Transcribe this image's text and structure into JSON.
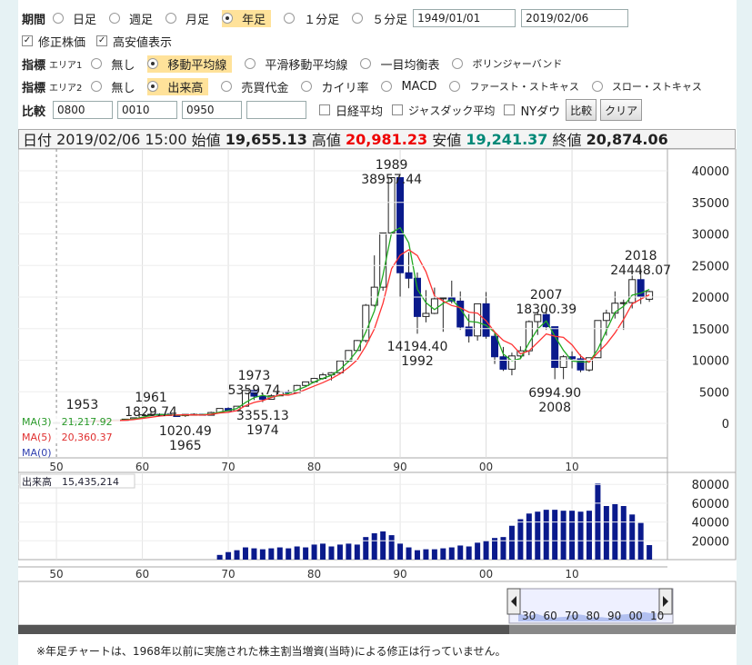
{
  "controls": {
    "period_label": "期間",
    "period_options": [
      "日足",
      "週足",
      "月足",
      "年足",
      "１分足",
      "５分足"
    ],
    "period_selected": "年足",
    "date_from": "1949/01/01",
    "date_to": "2019/02/06",
    "adjusted_label": "修正株価",
    "highlow_label": "高安値表示",
    "indicator_label": "指標",
    "area1_label": "エリア1",
    "area1_options": [
      "無し",
      "移動平均線",
      "平滑移動平均線",
      "一目均衡表",
      "ボリンジャーバンド"
    ],
    "area1_selected": "移動平均線",
    "area2_label": "エリア2",
    "area2_options": [
      "無し",
      "出来高",
      "売買代金",
      "カイリ率",
      "MACD",
      "ファースト・ストキャス",
      "スロー・ストキャス"
    ],
    "area2_selected": "出来高",
    "compare_label": "比較",
    "compare_codes": [
      "0800",
      "0010",
      "0950",
      ""
    ],
    "compare_checks": [
      "日経平均",
      "ジャスダック平均",
      "NYダウ"
    ],
    "compare_button": "比較",
    "clear_button": "クリア"
  },
  "info": {
    "date_label": "日付",
    "date_value": "2019/02/06 15:00",
    "open_label": "始値",
    "open_value": "19,655.13",
    "high_label": "高値",
    "high_value": "20,981.23",
    "low_label": "安値",
    "low_value": "19,241.37",
    "close_label": "終値",
    "close_value": "20,874.06"
  },
  "ma_legend": [
    "MA(3)　21,217.92",
    "MA(5)　20,360.37",
    "MA(0)"
  ],
  "volume_legend": "出来高　15,435,214",
  "x_ticks": [
    "50",
    "60",
    "70",
    "80",
    "90",
    "00",
    "10"
  ],
  "price_ticks": [
    "40000",
    "35000",
    "30000",
    "25000",
    "20000",
    "15000",
    "10000",
    "5000",
    "0"
  ],
  "volume_ticks": [
    "80000",
    "60000",
    "40000",
    "20000"
  ],
  "annotations": [
    {
      "line1": "1953",
      "line2": ""
    },
    {
      "line1": "1961",
      "line2": "1829.74"
    },
    {
      "line1": "1020.49",
      "line2": "1965"
    },
    {
      "line1": "1973",
      "line2": "5359.74"
    },
    {
      "line1": "3355.13",
      "line2": "1974"
    },
    {
      "line1": "1989",
      "line2": "38957.44"
    },
    {
      "line1": "14194.40",
      "line2": "1992"
    },
    {
      "line1": "2007",
      "line2": "18300.39"
    },
    {
      "line1": "6994.90",
      "line2": "2008"
    },
    {
      "line1": "2018",
      "line2": "24448.07"
    }
  ],
  "navigator_ticks": [
    "30",
    "60",
    "70",
    "80",
    "90",
    "00",
    "10"
  ],
  "footnote": "※年足チャートは、1968年以前に実施された株主割当増資(当時)による修正は行っていません。",
  "colors": {
    "up": "#ffffff",
    "down": "#0a1a8c",
    "ma3": "#22aa22",
    "ma5": "#ff3333",
    "volume": "#0a1a8c",
    "highlight": "#ffe29a"
  },
  "chart_data": {
    "type": "candlestick",
    "x_label_years": [
      1950,
      1960,
      1970,
      1980,
      1990,
      2000,
      2010
    ],
    "y_range": [
      0,
      40000
    ],
    "candles": [
      {
        "year": 1950,
        "o": 100,
        "h": 120,
        "l": 90,
        "c": 101
      },
      {
        "year": 1951,
        "o": 101,
        "h": 170,
        "l": 95,
        "c": 166
      },
      {
        "year": 1952,
        "o": 166,
        "h": 370,
        "l": 160,
        "c": 362
      },
      {
        "year": 1953,
        "o": 362,
        "h": 474,
        "l": 295,
        "c": 377
      },
      {
        "year": 1954,
        "o": 377,
        "h": 380,
        "l": 315,
        "c": 356
      },
      {
        "year": 1955,
        "o": 356,
        "h": 430,
        "l": 350,
        "c": 425
      },
      {
        "year": 1956,
        "o": 425,
        "h": 550,
        "l": 420,
        "c": 549
      },
      {
        "year": 1957,
        "o": 549,
        "h": 600,
        "l": 470,
        "c": 474
      },
      {
        "year": 1958,
        "o": 474,
        "h": 670,
        "l": 470,
        "c": 666
      },
      {
        "year": 1959,
        "o": 666,
        "h": 880,
        "l": 660,
        "c": 874
      },
      {
        "year": 1960,
        "o": 874,
        "h": 1360,
        "l": 870,
        "c": 1356
      },
      {
        "year": 1961,
        "o": 1356,
        "h": 1829,
        "l": 1250,
        "c": 1432
      },
      {
        "year": 1962,
        "o": 1432,
        "h": 1600,
        "l": 1200,
        "c": 1420
      },
      {
        "year": 1963,
        "o": 1420,
        "h": 1630,
        "l": 1200,
        "c": 1225
      },
      {
        "year": 1964,
        "o": 1225,
        "h": 1380,
        "l": 1200,
        "c": 1216
      },
      {
        "year": 1965,
        "o": 1216,
        "h": 1420,
        "l": 1020,
        "c": 1417
      },
      {
        "year": 1966,
        "o": 1417,
        "h": 1590,
        "l": 1400,
        "c": 1430
      },
      {
        "year": 1967,
        "o": 1430,
        "h": 1510,
        "l": 1250,
        "c": 1283
      },
      {
        "year": 1968,
        "o": 1283,
        "h": 1850,
        "l": 1280,
        "c": 1714
      },
      {
        "year": 1969,
        "o": 1714,
        "h": 2360,
        "l": 1700,
        "c": 2358
      },
      {
        "year": 1970,
        "o": 2358,
        "h": 2534,
        "l": 1929,
        "c": 1987
      },
      {
        "year": 1971,
        "o": 1987,
        "h": 2740,
        "l": 1980,
        "c": 2713
      },
      {
        "year": 1972,
        "o": 2713,
        "h": 5207,
        "l": 2700,
        "c": 5207
      },
      {
        "year": 1973,
        "o": 5207,
        "h": 5359,
        "l": 3700,
        "c": 4306
      },
      {
        "year": 1974,
        "o": 4306,
        "h": 4800,
        "l": 3355,
        "c": 3817
      },
      {
        "year": 1975,
        "o": 3817,
        "h": 4600,
        "l": 3800,
        "c": 4358
      },
      {
        "year": 1976,
        "o": 4358,
        "h": 5000,
        "l": 4350,
        "c": 4990
      },
      {
        "year": 1977,
        "o": 4990,
        "h": 5300,
        "l": 4600,
        "c": 4865
      },
      {
        "year": 1978,
        "o": 4865,
        "h": 6100,
        "l": 4860,
        "c": 6001
      },
      {
        "year": 1979,
        "o": 6001,
        "h": 6600,
        "l": 5900,
        "c": 6569
      },
      {
        "year": 1980,
        "o": 6569,
        "h": 7200,
        "l": 6400,
        "c": 7116
      },
      {
        "year": 1981,
        "o": 7116,
        "h": 8000,
        "l": 6900,
        "c": 7681
      },
      {
        "year": 1982,
        "o": 7681,
        "h": 8100,
        "l": 6800,
        "c": 8016
      },
      {
        "year": 1983,
        "o": 8016,
        "h": 9900,
        "l": 7900,
        "c": 9893
      },
      {
        "year": 1984,
        "o": 9893,
        "h": 11600,
        "l": 9700,
        "c": 11542
      },
      {
        "year": 1985,
        "o": 11542,
        "h": 13200,
        "l": 11500,
        "c": 13113
      },
      {
        "year": 1986,
        "o": 13113,
        "h": 18900,
        "l": 12800,
        "c": 18701
      },
      {
        "year": 1987,
        "o": 18701,
        "h": 26600,
        "l": 18500,
        "c": 21564
      },
      {
        "year": 1988,
        "o": 21564,
        "h": 30200,
        "l": 21000,
        "c": 30159
      },
      {
        "year": 1989,
        "o": 30159,
        "h": 38957,
        "l": 30000,
        "c": 38916
      },
      {
        "year": 1990,
        "o": 38916,
        "h": 38950,
        "l": 20000,
        "c": 23849
      },
      {
        "year": 1991,
        "o": 23849,
        "h": 27100,
        "l": 21400,
        "c": 22984
      },
      {
        "year": 1992,
        "o": 22984,
        "h": 23900,
        "l": 14194,
        "c": 16925
      },
      {
        "year": 1993,
        "o": 16925,
        "h": 21100,
        "l": 16000,
        "c": 17417
      },
      {
        "year": 1994,
        "o": 17417,
        "h": 21500,
        "l": 17300,
        "c": 19723
      },
      {
        "year": 1995,
        "o": 19723,
        "h": 20000,
        "l": 14500,
        "c": 19868
      },
      {
        "year": 1996,
        "o": 19868,
        "h": 22600,
        "l": 19000,
        "c": 19361
      },
      {
        "year": 1997,
        "o": 19361,
        "h": 20900,
        "l": 14800,
        "c": 15259
      },
      {
        "year": 1998,
        "o": 15259,
        "h": 17300,
        "l": 12800,
        "c": 13842
      },
      {
        "year": 1999,
        "o": 13842,
        "h": 19000,
        "l": 13100,
        "c": 18934
      },
      {
        "year": 2000,
        "o": 18934,
        "h": 20800,
        "l": 13400,
        "c": 13785
      },
      {
        "year": 2001,
        "o": 13785,
        "h": 14500,
        "l": 9400,
        "c": 10542
      },
      {
        "year": 2002,
        "o": 10542,
        "h": 12100,
        "l": 8300,
        "c": 8578
      },
      {
        "year": 2003,
        "o": 8578,
        "h": 11200,
        "l": 7607,
        "c": 10676
      },
      {
        "year": 2004,
        "o": 10676,
        "h": 12200,
        "l": 10300,
        "c": 11488
      },
      {
        "year": 2005,
        "o": 11488,
        "h": 16300,
        "l": 10800,
        "c": 16111
      },
      {
        "year": 2006,
        "o": 16111,
        "h": 17600,
        "l": 14000,
        "c": 17225
      },
      {
        "year": 2007,
        "o": 17225,
        "h": 18300,
        "l": 14800,
        "c": 15307
      },
      {
        "year": 2008,
        "o": 15307,
        "h": 15150,
        "l": 6994,
        "c": 8859
      },
      {
        "year": 2009,
        "o": 8859,
        "h": 10800,
        "l": 7000,
        "c": 10546
      },
      {
        "year": 2010,
        "o": 10546,
        "h": 11400,
        "l": 8700,
        "c": 10228
      },
      {
        "year": 2011,
        "o": 10228,
        "h": 10900,
        "l": 8100,
        "c": 8455
      },
      {
        "year": 2012,
        "o": 8455,
        "h": 10400,
        "l": 8200,
        "c": 10395
      },
      {
        "year": 2013,
        "o": 10395,
        "h": 16300,
        "l": 10400,
        "c": 16291
      },
      {
        "year": 2014,
        "o": 16291,
        "h": 18000,
        "l": 13900,
        "c": 17450
      },
      {
        "year": 2015,
        "o": 17450,
        "h": 20900,
        "l": 16600,
        "c": 19033
      },
      {
        "year": 2016,
        "o": 19033,
        "h": 19600,
        "l": 14800,
        "c": 19114
      },
      {
        "year": 2017,
        "o": 19114,
        "h": 23400,
        "l": 18200,
        "c": 22764
      },
      {
        "year": 2018,
        "o": 22764,
        "h": 24448,
        "l": 18900,
        "c": 20014
      },
      {
        "year": 2019,
        "o": 19655,
        "h": 20981,
        "l": 19241,
        "c": 20874
      }
    ],
    "volume_y_range": [
      0,
      90000
    ],
    "volume": [
      {
        "year": 1969,
        "v": 5000
      },
      {
        "year": 1970,
        "v": 8000
      },
      {
        "year": 1971,
        "v": 10000
      },
      {
        "year": 1972,
        "v": 13000
      },
      {
        "year": 1973,
        "v": 12000
      },
      {
        "year": 1974,
        "v": 11000
      },
      {
        "year": 1975,
        "v": 12000
      },
      {
        "year": 1976,
        "v": 13000
      },
      {
        "year": 1977,
        "v": 12000
      },
      {
        "year": 1978,
        "v": 14000
      },
      {
        "year": 1979,
        "v": 13000
      },
      {
        "year": 1980,
        "v": 16000
      },
      {
        "year": 1981,
        "v": 17000
      },
      {
        "year": 1982,
        "v": 14000
      },
      {
        "year": 1983,
        "v": 16000
      },
      {
        "year": 1984,
        "v": 17000
      },
      {
        "year": 1985,
        "v": 16000
      },
      {
        "year": 1986,
        "v": 24000
      },
      {
        "year": 1987,
        "v": 28000
      },
      {
        "year": 1988,
        "v": 30000
      },
      {
        "year": 1989,
        "v": 26000
      },
      {
        "year": 1990,
        "v": 17000
      },
      {
        "year": 1991,
        "v": 13000
      },
      {
        "year": 1992,
        "v": 10000
      },
      {
        "year": 1993,
        "v": 11000
      },
      {
        "year": 1994,
        "v": 11000
      },
      {
        "year": 1995,
        "v": 12000
      },
      {
        "year": 1996,
        "v": 13000
      },
      {
        "year": 1997,
        "v": 15000
      },
      {
        "year": 1998,
        "v": 14000
      },
      {
        "year": 1999,
        "v": 18000
      },
      {
        "year": 2000,
        "v": 20000
      },
      {
        "year": 2001,
        "v": 23000
      },
      {
        "year": 2002,
        "v": 24000
      },
      {
        "year": 2003,
        "v": 36000
      },
      {
        "year": 2004,
        "v": 43000
      },
      {
        "year": 2005,
        "v": 49000
      },
      {
        "year": 2006,
        "v": 51000
      },
      {
        "year": 2007,
        "v": 53000
      },
      {
        "year": 2008,
        "v": 53000
      },
      {
        "year": 2009,
        "v": 52000
      },
      {
        "year": 2010,
        "v": 52000
      },
      {
        "year": 2011,
        "v": 51000
      },
      {
        "year": 2012,
        "v": 52000
      },
      {
        "year": 2013,
        "v": 81000
      },
      {
        "year": 2014,
        "v": 57000
      },
      {
        "year": 2015,
        "v": 59000
      },
      {
        "year": 2016,
        "v": 57000
      },
      {
        "year": 2017,
        "v": 48000
      },
      {
        "year": 2018,
        "v": 39000
      },
      {
        "year": 2019,
        "v": 15435
      }
    ]
  }
}
